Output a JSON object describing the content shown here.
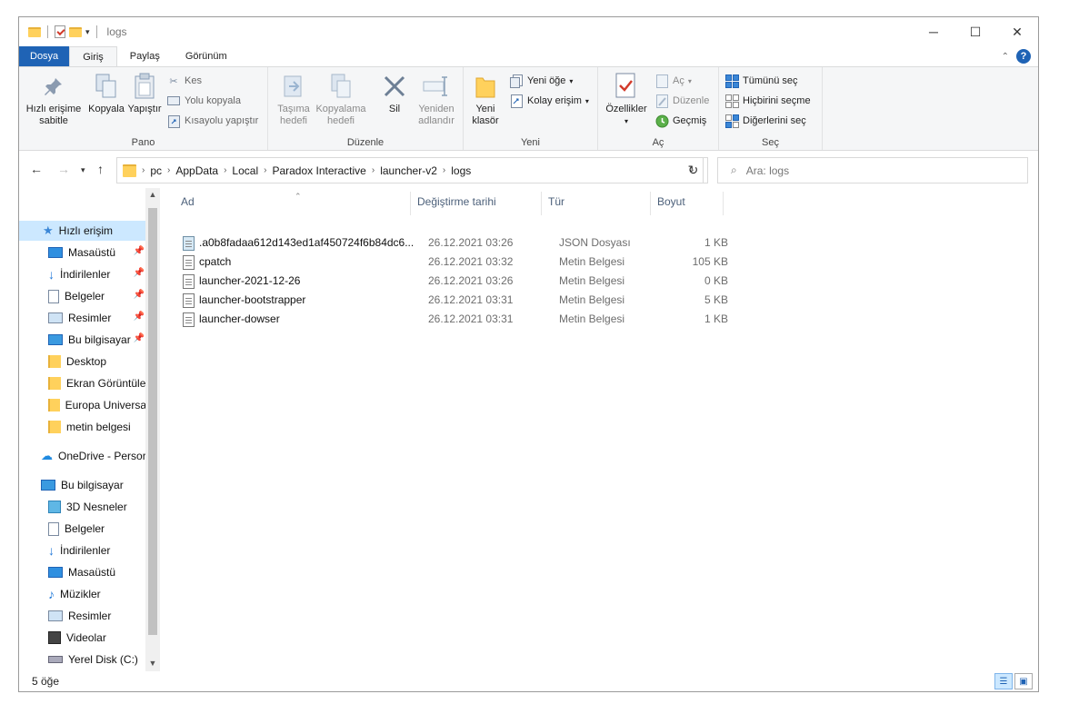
{
  "window": {
    "title": "logs"
  },
  "caption": {
    "minimize": "─",
    "maximize": "☐",
    "close": "✕"
  },
  "tabs": [
    "Dosya",
    "Giriş",
    "Paylaş",
    "Görünüm"
  ],
  "help": "?",
  "ribbon": {
    "pano": {
      "label": "Pano",
      "pin": "Hızlı erişime sabitle",
      "copy": "Kopyala",
      "paste": "Yapıştır",
      "cut": "Kes",
      "copy_path": "Yolu kopyala",
      "paste_shortcut": "Kısayolu yapıştır"
    },
    "duzenle": {
      "label": "Düzenle",
      "move_to": "Taşıma hedefi",
      "copy_to": "Kopyalama hedefi",
      "delete": "Sil",
      "rename": "Yeniden adlandır"
    },
    "yeni": {
      "label": "Yeni",
      "new_folder": "Yeni klasör",
      "new_item": "Yeni öğe",
      "easy_access": "Kolay erişim"
    },
    "ac": {
      "label": "Aç",
      "properties": "Özellikler",
      "open": "Aç",
      "edit": "Düzenle",
      "history": "Geçmiş"
    },
    "sec": {
      "label": "Seç",
      "select_all": "Tümünü seç",
      "select_none": "Hiçbirini seçme",
      "invert": "Diğerlerini seç"
    }
  },
  "address": {
    "breadcrumbs": [
      "pc",
      "AppData",
      "Local",
      "Paradox Interactive",
      "launcher-v2",
      "logs"
    ]
  },
  "search": {
    "placeholder": "Ara: logs"
  },
  "nav": {
    "quick_access": "Hızlı erişim",
    "items": [
      {
        "label": "Masaüstü",
        "icon": "desktop-icon",
        "pinned": true
      },
      {
        "label": "İndirilenler",
        "icon": "download-icon",
        "pinned": true
      },
      {
        "label": "Belgeler",
        "icon": "documents-icon",
        "pinned": true
      },
      {
        "label": "Resimler",
        "icon": "pictures-icon",
        "pinned": true
      },
      {
        "label": "Bu bilgisayar",
        "icon": "computer-icon",
        "pinned": true
      },
      {
        "label": "Desktop",
        "icon": "folder-icon",
        "pinned": false
      },
      {
        "label": "Ekran Görüntüle",
        "icon": "folder-icon",
        "pinned": false
      },
      {
        "label": "Europa Universa",
        "icon": "folder-icon",
        "pinned": false
      },
      {
        "label": "metin belgesi",
        "icon": "folder-icon",
        "pinned": false
      }
    ],
    "onedrive": "OneDrive - Persor",
    "this_pc": "Bu bilgisayar",
    "pc_items": [
      {
        "label": "3D Nesneler",
        "icon": "3d-objects-icon"
      },
      {
        "label": "Belgeler",
        "icon": "documents-icon"
      },
      {
        "label": "İndirilenler",
        "icon": "download-icon"
      },
      {
        "label": "Masaüstü",
        "icon": "desktop-icon"
      },
      {
        "label": "Müzikler",
        "icon": "music-icon"
      },
      {
        "label": "Resimler",
        "icon": "pictures-icon"
      },
      {
        "label": "Videolar",
        "icon": "videos-icon"
      },
      {
        "label": "Yerel Disk (C:)",
        "icon": "disk-icon"
      }
    ]
  },
  "columns": {
    "name": "Ad",
    "date": "Değiştirme tarihi",
    "type": "Tür",
    "size": "Boyut"
  },
  "files": [
    {
      "name": ".a0b8fadaa612d143ed1af450724f6b84dc6...",
      "date": "26.12.2021 03:26",
      "type": "JSON Dosyası",
      "size": "1 KB",
      "icon": "json-file-icon"
    },
    {
      "name": "cpatch",
      "date": "26.12.2021 03:32",
      "type": "Metin Belgesi",
      "size": "105 KB",
      "icon": "text-file-icon"
    },
    {
      "name": "launcher-2021-12-26",
      "date": "26.12.2021 03:26",
      "type": "Metin Belgesi",
      "size": "0 KB",
      "icon": "text-file-icon"
    },
    {
      "name": "launcher-bootstrapper",
      "date": "26.12.2021 03:31",
      "type": "Metin Belgesi",
      "size": "5 KB",
      "icon": "text-file-icon"
    },
    {
      "name": "launcher-dowser",
      "date": "26.12.2021 03:31",
      "type": "Metin Belgesi",
      "size": "1 KB",
      "icon": "text-file-icon"
    }
  ],
  "status": {
    "count": "5 öğe"
  },
  "colors": {
    "accent": "#1f63b5",
    "selection": "#cce8ff",
    "folder": "#ffd15c"
  }
}
